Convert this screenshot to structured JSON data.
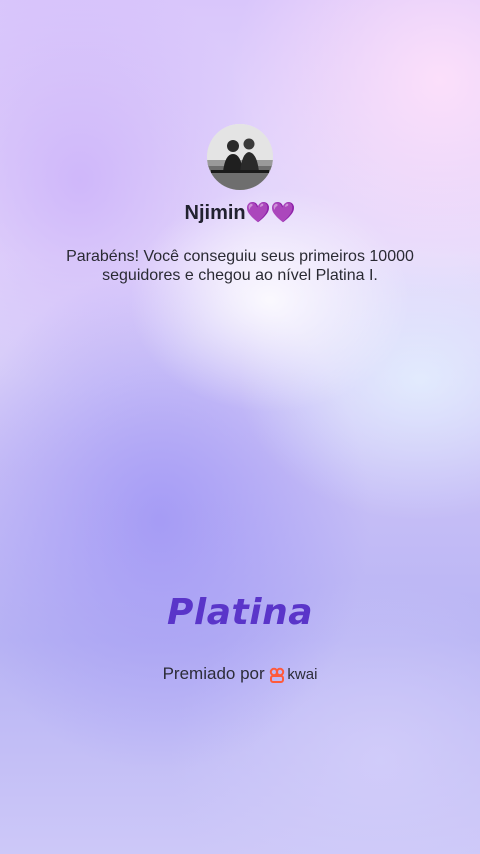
{
  "profile": {
    "username": "Njimin💜💜"
  },
  "message": {
    "text": "Parabéns! Você conseguiu seus primeiros 10000 seguidores e chegou ao nível Platina I."
  },
  "tier": {
    "label": "Platina"
  },
  "footer": {
    "awarded_by": "Premiado por",
    "brand_name": "kwai",
    "brand_logo_icon": "kwai-logo-icon",
    "brand_color": "#ff5a3c"
  },
  "colors": {
    "tier_text": "#5a35c9"
  }
}
